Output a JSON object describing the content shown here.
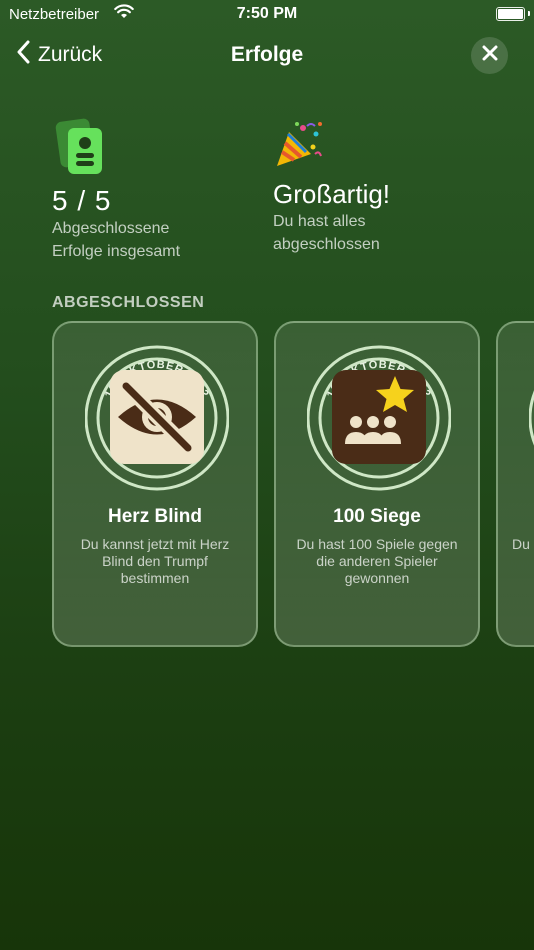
{
  "status": {
    "carrier": "Netzbetreiber",
    "time": "7:50 PM"
  },
  "nav": {
    "back_label": "Zurück",
    "title": "Erfolge"
  },
  "summary": {
    "count": "5 / 5",
    "count_label": "Abgeschlossene Erfolge insgesamt",
    "headline": "Großartig!",
    "headline_sub": "Du hast alles abgeschlossen"
  },
  "section": {
    "title": "ABGESCHLOSSEN"
  },
  "achievements": [
    {
      "date": "12. OKTOBER 2022",
      "title": "Herz Blind",
      "desc": "Du kannst jetzt mit Herz Blind den Trumpf bestimmen",
      "icon": "eye-slash-icon"
    },
    {
      "date": "12. OKTOBER 2022",
      "title": "100 Siege",
      "desc": "Du hast 100 Spiele gegen die anderen Spieler gewonnen",
      "icon": "group-star-icon"
    },
    {
      "date": "",
      "title": "",
      "desc": "Du",
      "icon": ""
    }
  ],
  "colors": {
    "accent_green": "#66e15c",
    "badge_brown": "#4a2c17",
    "badge_cream": "#efe3c9",
    "star_yellow": "#f6d21c"
  }
}
